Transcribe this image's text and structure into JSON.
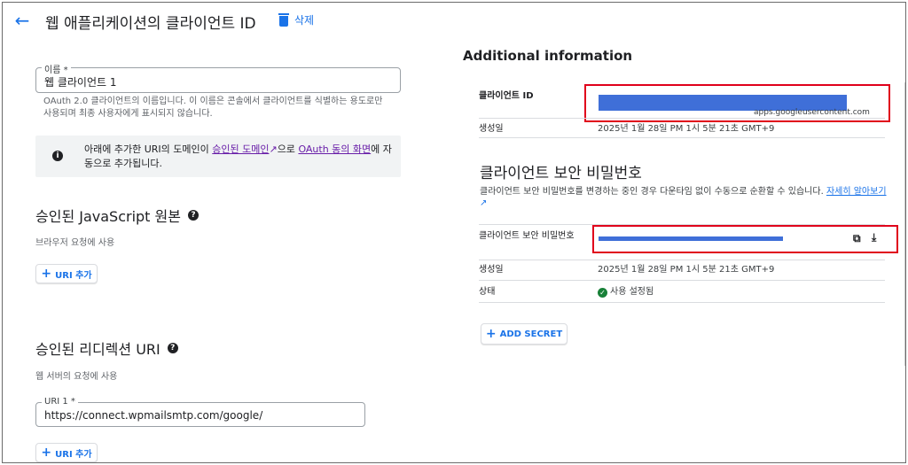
{
  "header": {
    "title": "웹 애플리케이션의 클라이언트 ID",
    "delete_label": "삭제"
  },
  "name_field": {
    "label": "이름 *",
    "value": "웹 클라이언트 1",
    "help_line1": "OAuth 2.0 클라이언트의 이름입니다. 이 이름은 콘솔에서 클라이언트를 식별하는 용도로만",
    "help_line2": "사용되며 최종 사용자에게 표시되지 않습니다."
  },
  "notice": {
    "text_before": "아래에 추가한 URI의 도메인이 ",
    "link1": "승인된 도메인",
    "text_mid": "으로 ",
    "link2": "OAuth 동의 화면",
    "text_after": "에 자동으로 추가됩니다."
  },
  "js_origins": {
    "title": "승인된 JavaScript 원본",
    "subtitle": "브라우저 요청에 사용",
    "add_label": "URI 추가"
  },
  "redirect_uris": {
    "title": "승인된 리디렉션 URI",
    "subtitle": "웹 서버의 요청에 사용",
    "field_label": "URI 1 *",
    "field_value": "https://connect.wpmailsmtp.com/google/",
    "add_label": "URI 추가"
  },
  "additional": {
    "title": "Additional information",
    "client_id_label": "클라이언트 ID",
    "client_id_tail": "apps.googleusercontent.com",
    "created_label": "생성일",
    "created_value": "2025년 1월 28일 PM 1시 5분 21초 GMT+9"
  },
  "secret": {
    "title": "클라이언트 보안 비밀번호",
    "help": "클라이언트 보안 비밀번호를 변경하는 중인 경우 다운타임 없이 수동으로 순환할 수 있습니다.",
    "help_link": "자세히 알아보기",
    "secret_label": "클라이언트 보안 비밀번호",
    "created_label": "생성일",
    "created_value": "2025년 1월 28일 PM 1시 5분 21초 GMT+9",
    "status_label": "상태",
    "status_value": "사용 설정됨",
    "add_secret_label": "ADD SECRET"
  },
  "colors": {
    "accent": "#1a73e8",
    "highlight": "#e0001b",
    "redaction": "#3f6fd8",
    "enabled": "#188038"
  },
  "icons": [
    "arrow-back-icon",
    "trash-icon",
    "info-icon",
    "help-icon",
    "plus-icon",
    "copy-icon",
    "download-icon",
    "check-circle-icon",
    "external-link-icon"
  ]
}
